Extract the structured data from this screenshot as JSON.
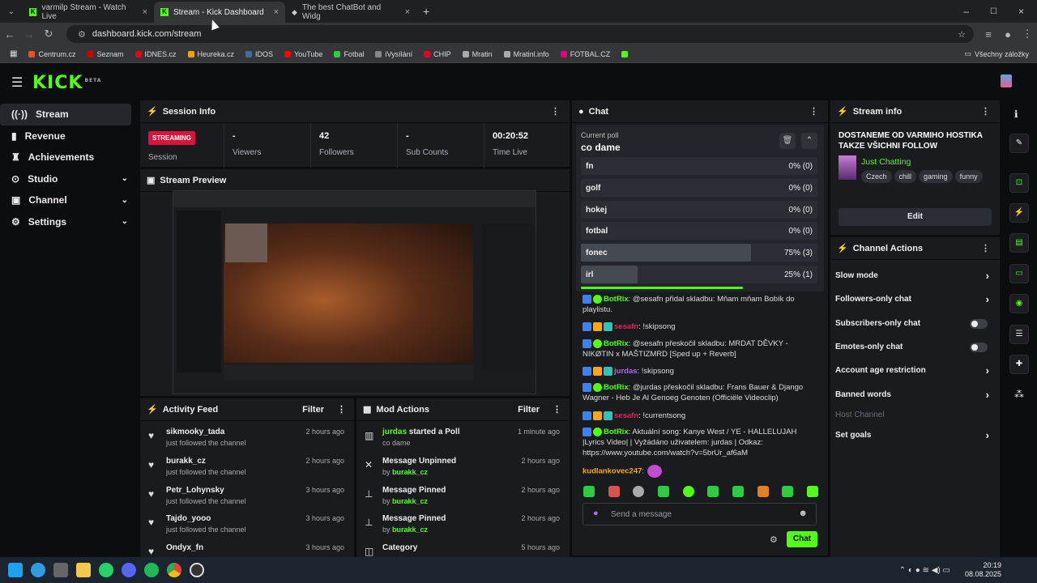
{
  "browser": {
    "tabs": [
      {
        "title": "varmilp Stream - Watch Live"
      },
      {
        "title": "Stream - Kick Dashboard"
      },
      {
        "title": "The best ChatBot and Widg"
      }
    ],
    "url": "dashboard.kick.com/stream",
    "bookmarks": [
      "Centrum.cz",
      "Seznam",
      "IDNES.cz",
      "Heureka.cz",
      "IDOS",
      "YouTube",
      "Fotbal",
      "iVysílání",
      "CHIP",
      "Mratin",
      "Mratinl.info",
      "FOTBAL.CZ"
    ],
    "all_bookmarks": "Všechny záložky"
  },
  "logo": {
    "text": "KICK",
    "beta": "BETA"
  },
  "sidebar": {
    "items": [
      {
        "label": "Stream"
      },
      {
        "label": "Revenue"
      },
      {
        "label": "Achievements"
      },
      {
        "label": "Studio"
      },
      {
        "label": "Channel"
      },
      {
        "label": "Settings"
      }
    ]
  },
  "session": {
    "title": "Session Info",
    "status_badge": "STREAMING",
    "status_label": "Session",
    "stats": [
      {
        "value": "-",
        "label": "Viewers"
      },
      {
        "value": "42",
        "label": "Followers"
      },
      {
        "value": "-",
        "label": "Sub Counts"
      },
      {
        "value": "00:20:52",
        "label": "Time Live"
      }
    ]
  },
  "preview": {
    "title": "Stream Preview"
  },
  "activity": {
    "title": "Activity Feed",
    "filter": "Filter",
    "items": [
      {
        "name": "sikmooky_tada",
        "action": "just followed the channel",
        "time": "2 hours ago"
      },
      {
        "name": "burakk_cz",
        "action": "just followed the channel",
        "time": "2 hours ago"
      },
      {
        "name": "Petr_Lohynsky",
        "action": "just followed the channel",
        "time": "3 hours ago"
      },
      {
        "name": "Tajdo_yooo",
        "action": "just followed the channel",
        "time": "3 hours ago"
      },
      {
        "name": "Ondyx_fn",
        "action": "",
        "time": "3 hours ago"
      }
    ]
  },
  "mod": {
    "title": "Mod Actions",
    "filter": "Filter",
    "items": [
      {
        "name": "jurdas",
        "action": " started a Poll",
        "sub": "co dame",
        "by": "",
        "time": "1 minute ago"
      },
      {
        "name": "",
        "action": "Message Unpinned",
        "sub": "by ",
        "by": "burakk_cz",
        "time": "2 hours ago"
      },
      {
        "name": "",
        "action": "Message Pinned",
        "sub": "by ",
        "by": "burakk_cz",
        "time": "2 hours ago"
      },
      {
        "name": "",
        "action": "Message Pinned",
        "sub": "by ",
        "by": "burakk_cz",
        "time": "2 hours ago"
      },
      {
        "name": "",
        "action": "Category",
        "sub": "",
        "by": "",
        "time": "5 hours ago"
      }
    ]
  },
  "chat": {
    "title": "Chat",
    "poll": {
      "label": "Current poll",
      "question": "co dame",
      "options": [
        {
          "label": "fn",
          "result": "0% (0)",
          "fraction": 0
        },
        {
          "label": "golf",
          "result": "0% (0)",
          "fraction": 0
        },
        {
          "label": "hokej",
          "result": "0% (0)",
          "fraction": 0
        },
        {
          "label": "fotbal",
          "result": "0% (0)",
          "fraction": 0
        },
        {
          "label": "fonec",
          "result": "75% (3)",
          "fraction": 0.75
        },
        {
          "label": "irl",
          "result": "25% (1)",
          "fraction": 0.25
        }
      ]
    },
    "messages": [
      {
        "user": "BotRix",
        "color": "#53fc18",
        "text": ": @sesafn přidal skladbu: Mňam mňam Bobík do playlistu."
      },
      {
        "user": "sesafn",
        "color": "#e0245e",
        "text": ": !skipsong"
      },
      {
        "user": "BotRix",
        "color": "#53fc18",
        "text": ": @sesafn přeskočil skladbu: MRDAT DĚVKY - NIKØTIN x MAŠTIZMRD [Sped up + Reverb]"
      },
      {
        "user": "jurdas",
        "color": "#b164ff",
        "text": ": !skipsong"
      },
      {
        "user": "BotRix",
        "color": "#53fc18",
        "text": ": @jurdas přeskočil skladbu: Frans Bauer & Django Wagner - Heb Je Al Genoeg Genoten (Officiële Videoclip)"
      },
      {
        "user": "sesafn",
        "color": "#e0245e",
        "text": ": !currentsong"
      },
      {
        "user": "BotRix",
        "color": "#53fc18",
        "text": ": Aktuální song: Kanye West / YE - HALLELUJAH |Lyrics Video| | Vyžádáno uživatelem: jurdas | Odkaz: https://www.youtube.com/watch?v=5brUr_af6aM"
      },
      {
        "user": "kudlankovec247",
        "color": "#f5a623",
        "text": ":"
      }
    ],
    "input_placeholder": "Send a message",
    "send": "Chat"
  },
  "stream_info": {
    "title": "Stream info",
    "stream_title": "DOSTANEME OD VARMIHO HOSTIKA TAKZE VŠICHNI FOLLOW",
    "category": "Just Chatting",
    "tags": [
      "Czech",
      "chill",
      "gaming",
      "funny"
    ],
    "edit": "Edit"
  },
  "channel_actions": {
    "title": "Channel Actions",
    "items": [
      {
        "label": "Slow mode",
        "type": "arrow"
      },
      {
        "label": "Followers-only chat",
        "type": "arrow"
      },
      {
        "label": "Subscribers-only chat",
        "type": "toggle"
      },
      {
        "label": "Emotes-only chat",
        "type": "toggle"
      },
      {
        "label": "Account age restriction",
        "type": "arrow"
      },
      {
        "label": "Banned words",
        "type": "arrow"
      },
      {
        "label": "Host Channel",
        "type": "disabled"
      },
      {
        "label": "Set goals",
        "type": "arrow"
      }
    ]
  },
  "taskbar": {
    "time": "20:19",
    "date": "08.08.2025"
  },
  "colors": {
    "brand": "#53fc18",
    "streaming": "#d9143a",
    "panel": "#191b1f",
    "background": "#0b0e0f"
  }
}
